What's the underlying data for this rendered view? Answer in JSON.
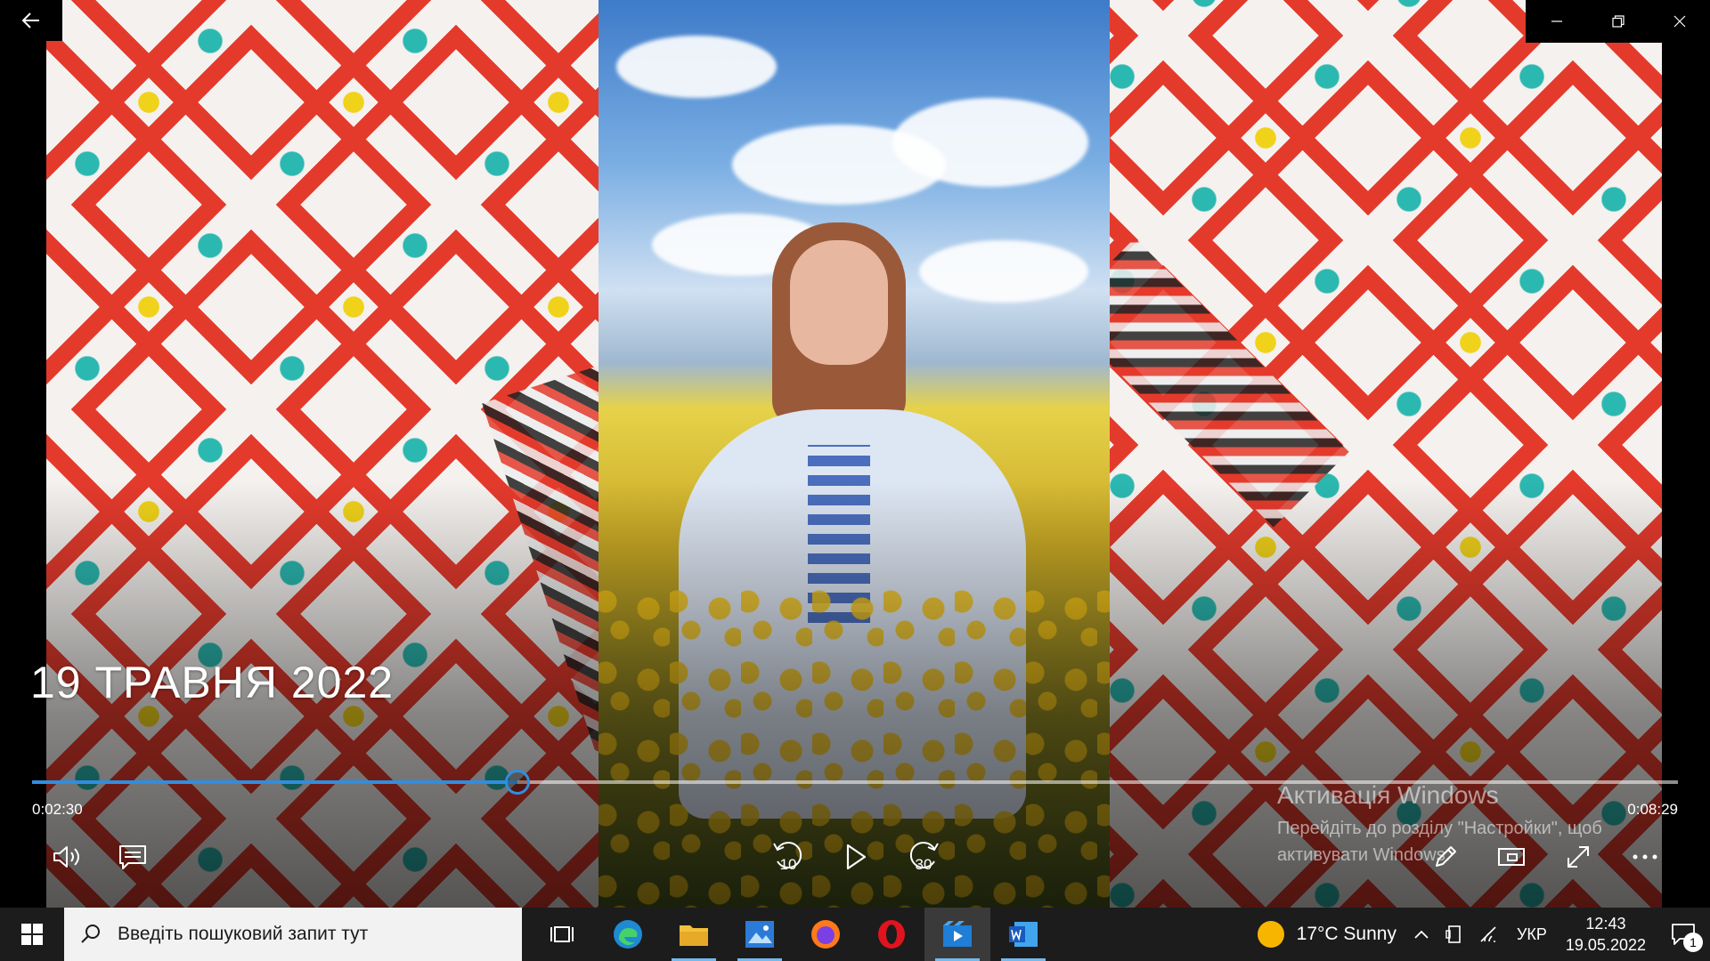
{
  "app": {
    "window_controls": {
      "minimize_icon": "minimize-icon",
      "restore_icon": "restore-icon",
      "close_icon": "close-icon"
    }
  },
  "video": {
    "title": "19 ТРАВНЯ 2022",
    "current_time": "0:02:30",
    "total_time": "0:08:29",
    "progress_fraction": 0.295,
    "skip_back_seconds": "10",
    "skip_forward_seconds": "30"
  },
  "activation": {
    "title": "Активація Windows",
    "line1": "Перейдіть до розділу \"Настройки\", щоб",
    "line2": "активувати Windows."
  },
  "taskbar": {
    "search_placeholder": "Введіть пошуковий запит тут",
    "weather": "17°C  Sunny",
    "language": "УКР",
    "time": "12:43",
    "date": "19.05.2022",
    "notifications_count": "1"
  },
  "colors": {
    "accent": "#2f8ee0",
    "taskbar": "#1c1c1c",
    "search_bg": "#f2f2f2"
  }
}
